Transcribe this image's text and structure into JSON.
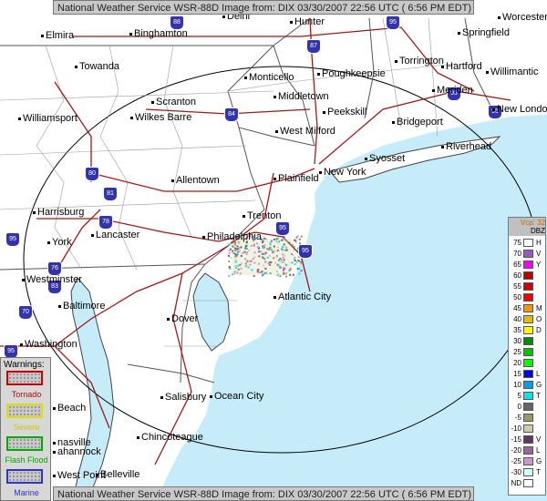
{
  "banner_top": "National Weather Service WSR-88D Image from: DIX 03/30/2007 22:56 UTC ( 6:56 PM EDT)",
  "banner_bottom": "National Weather Service WSR-88D Image from: DIX 03/30/2007 22:56 UTC ( 6:56 PM EDT)",
  "cities": [
    {
      "name": "Delhi"
    },
    {
      "name": "Hunter"
    },
    {
      "name": "Worcester"
    },
    {
      "name": "Elmira"
    },
    {
      "name": "Binghamton"
    },
    {
      "name": "Springfield"
    },
    {
      "name": "Towanda"
    },
    {
      "name": "Monticello"
    },
    {
      "name": "Poughkeepsie"
    },
    {
      "name": "Torrington"
    },
    {
      "name": "Hartford"
    },
    {
      "name": "Willimantic"
    },
    {
      "name": "Middletown"
    },
    {
      "name": "Meriden"
    },
    {
      "name": "Scranton"
    },
    {
      "name": "Peekskill"
    },
    {
      "name": "New London"
    },
    {
      "name": "Williamsport"
    },
    {
      "name": "Wilkes Barre"
    },
    {
      "name": "Bridgeport"
    },
    {
      "name": "West Milford"
    },
    {
      "name": "Riverhead"
    },
    {
      "name": "Syosset"
    },
    {
      "name": "Plainfield"
    },
    {
      "name": "New York"
    },
    {
      "name": "Allentown"
    },
    {
      "name": "Harrisburg"
    },
    {
      "name": "Trenton"
    },
    {
      "name": "Lancaster"
    },
    {
      "name": "Philadelphia"
    },
    {
      "name": "York"
    },
    {
      "name": "Westminster"
    },
    {
      "name": "Atlantic City"
    },
    {
      "name": "Baltimore"
    },
    {
      "name": "Dover"
    },
    {
      "name": "Washington"
    },
    {
      "name": "Salisbury"
    },
    {
      "name": "Ocean City"
    },
    {
      "name": "Chincoteague"
    },
    {
      "name": "Beach"
    },
    {
      "name": "nasville"
    },
    {
      "name": "ahannock"
    },
    {
      "name": "West Point"
    },
    {
      "name": "Belleville"
    }
  ],
  "highways": [
    "88",
    "87",
    "84",
    "80",
    "81",
    "78",
    "76",
    "83",
    "95",
    "70",
    "95",
    "95",
    "95",
    "95",
    "95",
    "95"
  ],
  "warnings": {
    "title": "Warnings:",
    "items": [
      {
        "label": "Tornado",
        "color": "#cc0000"
      },
      {
        "label": "Severe",
        "color": "#dddd00"
      },
      {
        "label": "Flash Flood",
        "color": "#00aa00"
      },
      {
        "label": "Marine",
        "color": "#3333cc"
      }
    ]
  },
  "legend": {
    "vcp": "Vcp: 32",
    "unit": "DBZ",
    "rows": [
      {
        "value": "75",
        "color": "#ffffff",
        "code": "H"
      },
      {
        "value": "70",
        "color": "#9955c9",
        "code": "V"
      },
      {
        "value": "65",
        "color": "#f800fd",
        "code": "Y"
      },
      {
        "value": "60",
        "color": "#bc0000",
        "code": ""
      },
      {
        "value": "55",
        "color": "#d40000",
        "code": ""
      },
      {
        "value": "50",
        "color": "#fd0000",
        "code": ""
      },
      {
        "value": "45",
        "color": "#fd9500",
        "code": "M"
      },
      {
        "value": "40",
        "color": "#e5bc00",
        "code": "O"
      },
      {
        "value": "35",
        "color": "#fdf802",
        "code": "D"
      },
      {
        "value": "30",
        "color": "#008e00",
        "code": ""
      },
      {
        "value": "25",
        "color": "#01c501",
        "code": ""
      },
      {
        "value": "20",
        "color": "#02fd02",
        "code": ""
      },
      {
        "value": "15",
        "color": "#0300f4",
        "code": "L"
      },
      {
        "value": "10",
        "color": "#019ff4",
        "code": "G"
      },
      {
        "value": "5",
        "color": "#04e9e7",
        "code": "T"
      },
      {
        "value": "0",
        "color": "#666666",
        "code": ""
      },
      {
        "value": "-5",
        "color": "#999966",
        "code": ""
      },
      {
        "value": "-10",
        "color": "#ccccaa",
        "code": ""
      },
      {
        "value": "-15",
        "color": "#663366",
        "code": "V"
      },
      {
        "value": "-20",
        "color": "#996699",
        "code": "L"
      },
      {
        "value": "-25",
        "color": "#cc99cc",
        "code": "G"
      },
      {
        "value": "-30",
        "color": "#ccffff",
        "code": "T"
      },
      {
        "value": "ND",
        "color": "#ffffff",
        "code": ""
      }
    ]
  },
  "colors": {
    "ocean": "#c6ecfa",
    "land": "#ffffff",
    "roads": "#a01818",
    "boundaries": "#555555",
    "coast": "#444444",
    "range_ring": "#000000"
  }
}
